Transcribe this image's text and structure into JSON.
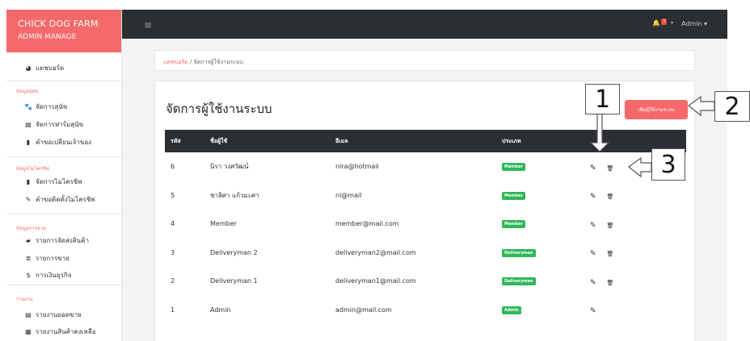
{
  "brand": {
    "title": "CHICK DOG FARM",
    "subtitle": "ADMIN MANAGE"
  },
  "sidebar": {
    "dashboard": "แดชบอร์ด",
    "sections": [
      {
        "head": "ข้อมูลสุนัข",
        "items": [
          {
            "icon": "paw-icon",
            "glyph": "🐾",
            "label": "จัดการสุนัข"
          },
          {
            "icon": "farm-icon",
            "glyph": "▤",
            "label": "จัดการฟาร์มสุนัข"
          },
          {
            "icon": "bookmark-icon",
            "glyph": "▮",
            "label": "คำขอเปลี่ยนเจ้าของ"
          }
        ]
      },
      {
        "head": "ข้อมูลไมโครชิพ",
        "items": [
          {
            "icon": "chip-icon",
            "glyph": "▮",
            "label": "จัดการไมโครชิพ"
          },
          {
            "icon": "pen-icon",
            "glyph": "✎",
            "label": "คำขอติดตั้งไมโครชิพ"
          }
        ]
      },
      {
        "head": "ข้อมูลการขาย",
        "items": [
          {
            "icon": "truck-icon",
            "glyph": "▰",
            "label": "รายการจัดส่งสินค้า"
          },
          {
            "icon": "list-icon",
            "glyph": "≣",
            "label": "รายการขาย"
          },
          {
            "icon": "dollar-icon",
            "glyph": "$",
            "label": "การเงินธุรกิจ"
          }
        ]
      },
      {
        "head": "รายงาน",
        "items": [
          {
            "icon": "report-icon",
            "glyph": "▤",
            "label": "รายงานยอดขาย"
          },
          {
            "icon": "stock-icon",
            "glyph": "▦",
            "label": "รายงานสินค้าคงเหลือ"
          }
        ]
      }
    ]
  },
  "topbar": {
    "menu_icon": "≡",
    "notif_count": "3",
    "user": "Admin"
  },
  "breadcrumb": {
    "home": "แดชบอร์ด",
    "separator": "/",
    "current": "จัดการผู้ใช้งานระบบ"
  },
  "page": {
    "title": "จัดการผู้ใช้งานระบบ",
    "add_button": "เพิ่มผู้ใช้งานระบบ",
    "table": {
      "headers": [
        "รหัส",
        "ชื่อผู้ใช้",
        "อีเมล",
        "ประเภท",
        ""
      ],
      "rows": [
        {
          "id": "6",
          "name": "นิรา วงศวัฒน์",
          "email": "nira@hotmail",
          "type": "Member",
          "actions": [
            "edit",
            "delete"
          ]
        },
        {
          "id": "5",
          "name": "ชาลิศา แก้วมะศา",
          "email": "ni@mail",
          "type": "Member",
          "actions": [
            "edit",
            "delete"
          ]
        },
        {
          "id": "4",
          "name": "Member",
          "email": "member@mail.com",
          "type": "Member",
          "actions": [
            "edit",
            "delete"
          ]
        },
        {
          "id": "3",
          "name": "Deliveryman 2",
          "email": "deliveryman2@mail.com",
          "type": "Deliveryman",
          "actions": [
            "edit",
            "delete"
          ]
        },
        {
          "id": "2",
          "name": "Deliveryman 1",
          "email": "deliveryman1@mail.com",
          "type": "Deliveryman",
          "actions": [
            "edit",
            "delete"
          ]
        },
        {
          "id": "1",
          "name": "Admin",
          "email": "admin@mail.com",
          "type": "Admin",
          "actions": [
            "edit"
          ]
        }
      ]
    }
  },
  "annotations": {
    "one": "1",
    "two": "2",
    "three": "3"
  },
  "colors": {
    "accent": "#f5696a",
    "topbar": "#2b2f33",
    "tag_green": "#2fb858"
  }
}
